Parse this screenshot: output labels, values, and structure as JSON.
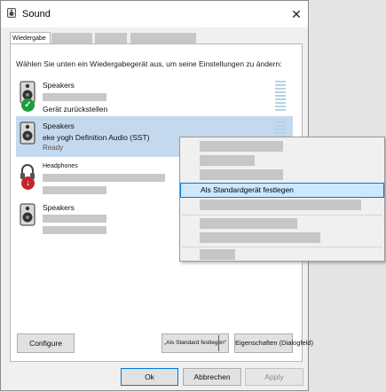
{
  "window": {
    "title": "Sound",
    "close_label": "✕"
  },
  "tabs": {
    "active_label": "Wiedergabe"
  },
  "instruction": "Wählen Sie unten ein Wiedergabegerät aus, um seine Einstellungen zu ändern:",
  "devices": [
    {
      "name": "Speakers",
      "status": "Gerät zurückstellen",
      "icon": "speaker-icon",
      "badge": "check-icon"
    },
    {
      "name": "Speakers",
      "detail": "eke yogh Definition Audio (SST)",
      "state": "Ready",
      "icon": "speaker-icon",
      "selected": true
    },
    {
      "name": "Headphones",
      "icon": "headphones-icon",
      "badge": "down-arrow-icon"
    },
    {
      "name": "Speakers",
      "icon": "speaker-icon"
    }
  ],
  "buttons": {
    "configure": "Configure",
    "set_default": "„Als Standard festlegen“",
    "properties": "Eigenschaften  (Dialogfeld)",
    "ok": "Ok",
    "cancel": "Abbrechen",
    "apply": "Apply"
  },
  "context_menu": {
    "highlighted_item": "Als Standardgerät festlegen"
  },
  "colors": {
    "selection": "#c5d9ee",
    "accent": "#0078d7",
    "check_badge": "#1e9c3a",
    "down_badge": "#c4262e"
  }
}
